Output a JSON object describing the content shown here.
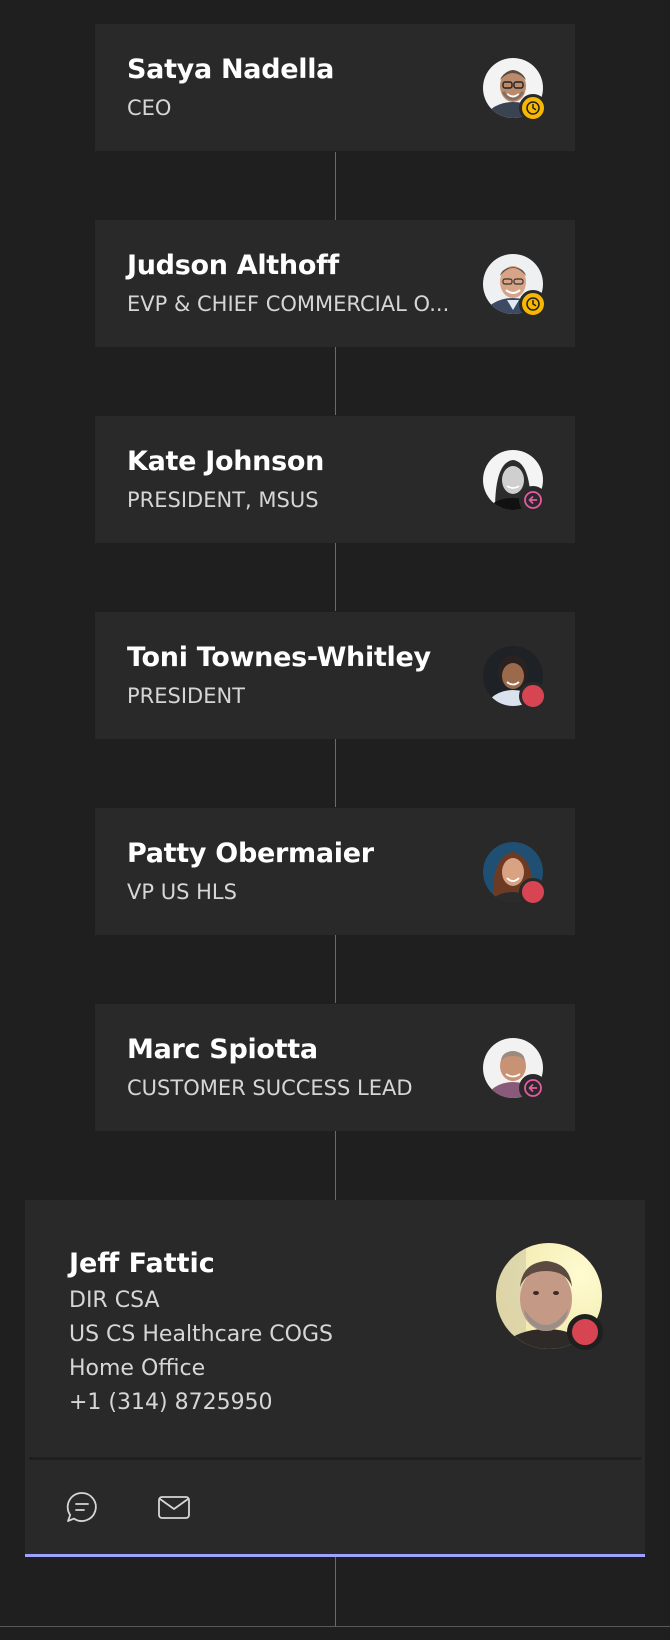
{
  "colors": {
    "background": "#1f1f1f",
    "card": "#292929",
    "away": "#f8b700",
    "busy": "#d74553",
    "out_of_office": "#e65aa3",
    "accent": "#9ea2ff"
  },
  "chain": [
    {
      "name": "Satya Nadella",
      "title": "CEO",
      "presence": "away",
      "icon": "clock-icon"
    },
    {
      "name": "Judson Althoff",
      "title": "EVP & CHIEF COMMERCIAL O...",
      "presence": "away",
      "icon": "clock-icon"
    },
    {
      "name": "Kate Johnson",
      "title": "PRESIDENT, MSUS",
      "presence": "out-of-office",
      "icon": "arrow-left-circle-icon"
    },
    {
      "name": "Toni Townes-Whitley",
      "title": "PRESIDENT",
      "presence": "busy",
      "icon": "busy-dot-icon"
    },
    {
      "name": "Patty Obermaier",
      "title": "VP US HLS",
      "presence": "busy",
      "icon": "busy-dot-icon"
    },
    {
      "name": "Marc Spiotta",
      "title": "CUSTOMER SUCCESS LEAD",
      "presence": "out-of-office",
      "icon": "arrow-left-circle-icon"
    }
  ],
  "person": {
    "name": "Jeff Fattic",
    "title": "DIR CSA",
    "department": "US CS Healthcare COGS",
    "location": "Home Office",
    "phone": "+1 (314) 8725950",
    "presence": "busy"
  },
  "actions": [
    {
      "icon": "chat-icon"
    },
    {
      "icon": "mail-icon"
    }
  ]
}
